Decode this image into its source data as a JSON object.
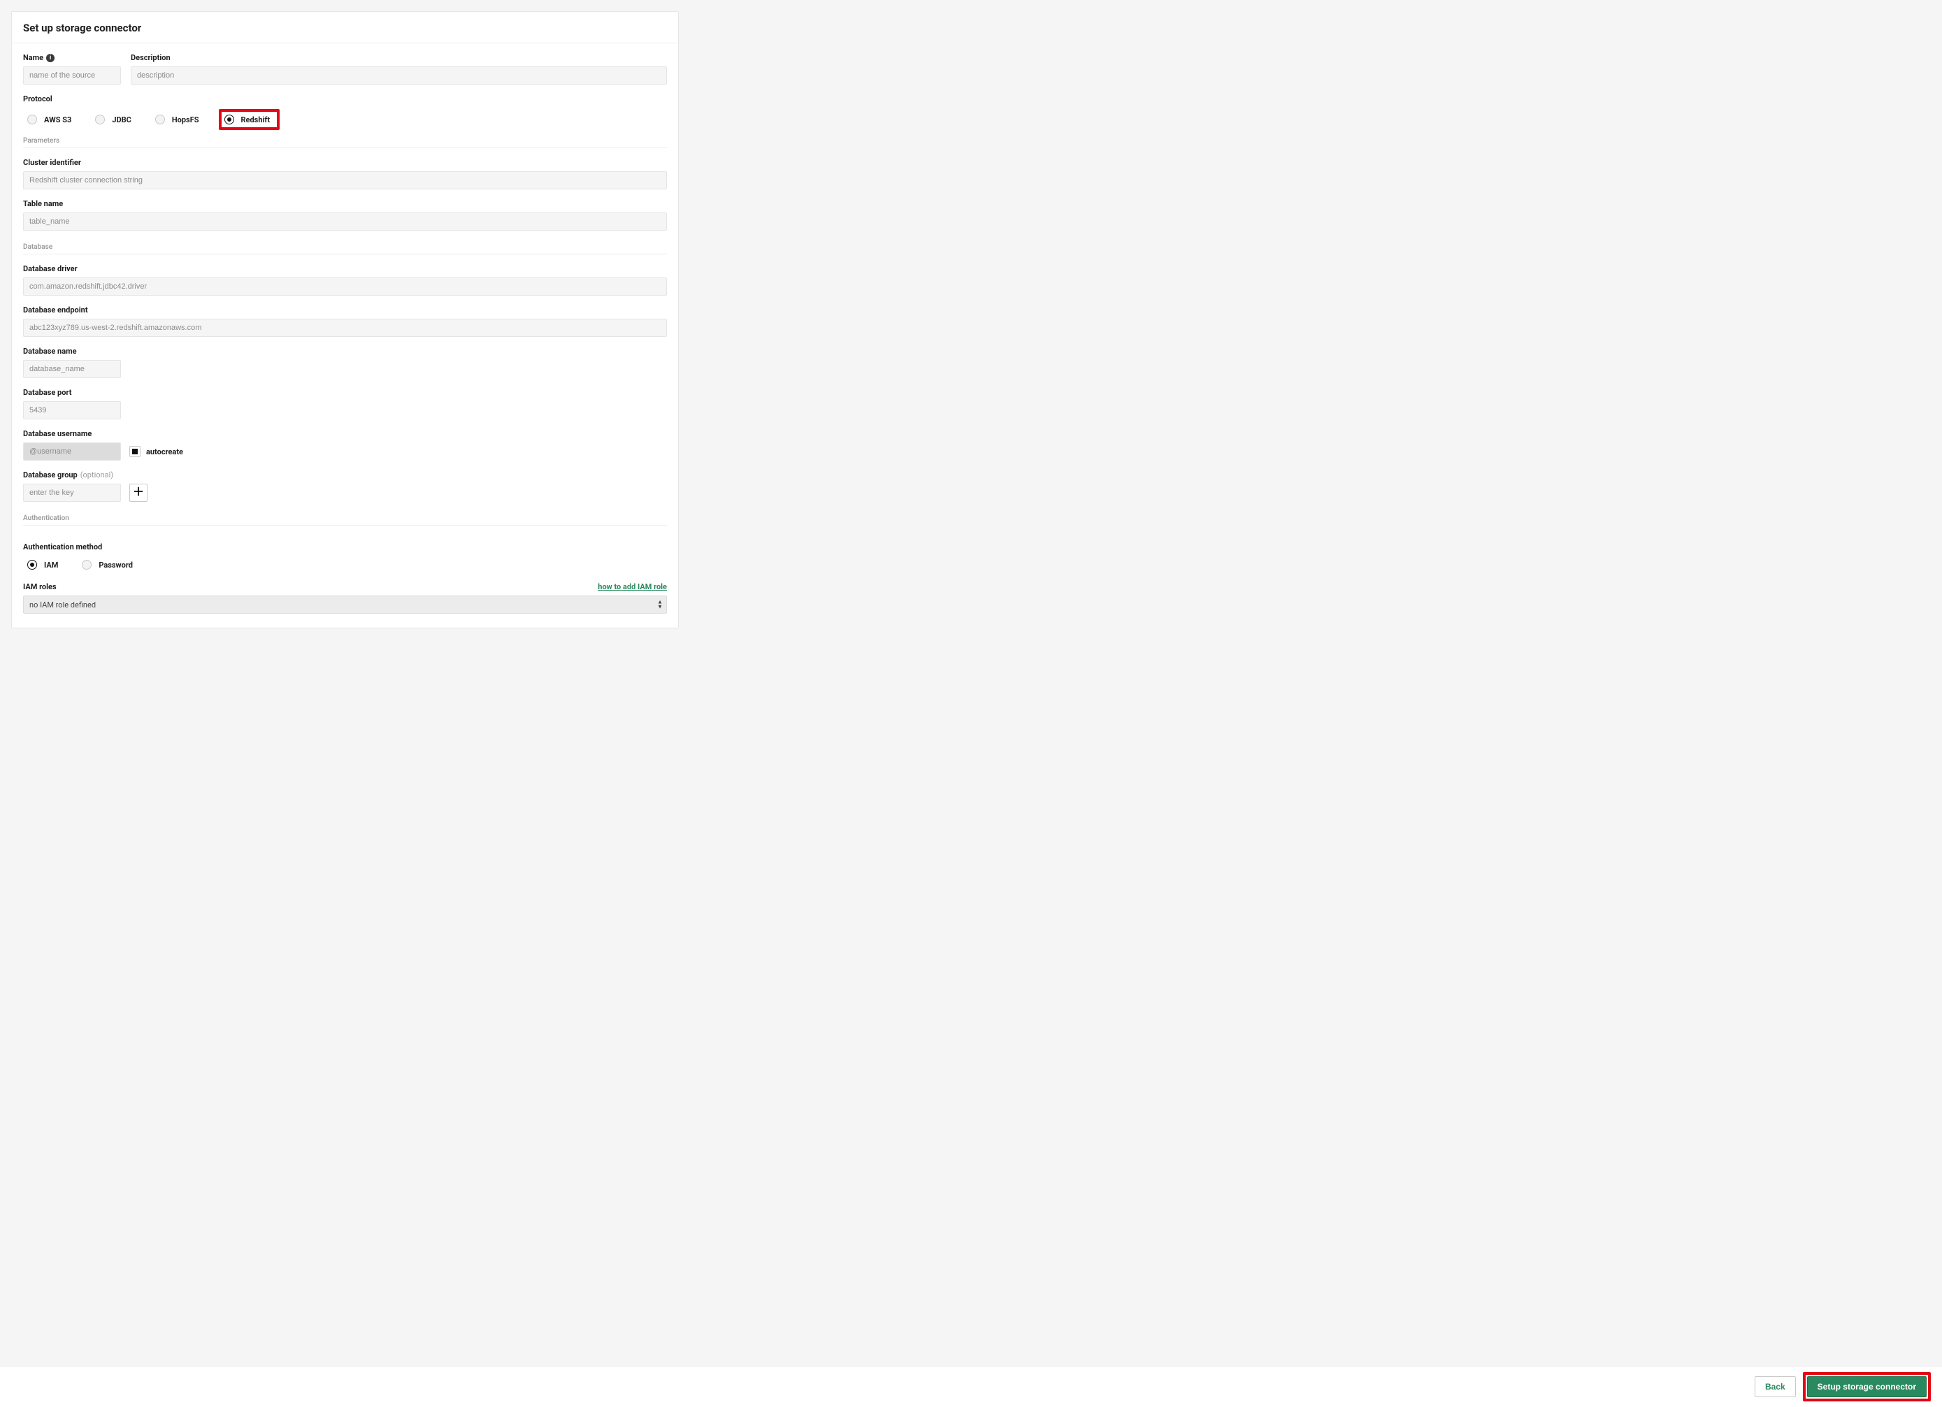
{
  "header": {
    "title": "Set up storage connector"
  },
  "form": {
    "name_label": "Name",
    "name_placeholder": "name of the source",
    "desc_label": "Description",
    "desc_placeholder": "description",
    "protocol_label": "Protocol",
    "protocols": [
      {
        "label": "AWS S3",
        "selected": false
      },
      {
        "label": "JDBC",
        "selected": false
      },
      {
        "label": "HopsFS",
        "selected": false
      },
      {
        "label": "Redshift",
        "selected": true
      }
    ],
    "section_parameters": "Parameters",
    "cluster_identifier": {
      "label": "Cluster identifier",
      "placeholder": "Redshift cluster connection string"
    },
    "table_name": {
      "label": "Table name",
      "placeholder": "table_name"
    },
    "section_database": "Database",
    "db_driver": {
      "label": "Database driver",
      "placeholder": "com.amazon.redshift.jdbc42.driver"
    },
    "db_endpoint": {
      "label": "Database endpoint",
      "placeholder": "abc123xyz789.us-west-2.redshift.amazonaws.com"
    },
    "db_name": {
      "label": "Database name",
      "placeholder": "database_name"
    },
    "db_port": {
      "label": "Database port",
      "placeholder": "5439"
    },
    "db_username": {
      "label": "Database username",
      "placeholder": "@username",
      "autocreate_label": "autocreate"
    },
    "db_group": {
      "label": "Database group",
      "optional": "(optional)",
      "placeholder": "enter the key"
    },
    "section_auth": "Authentication",
    "auth_method_label": "Authentication method",
    "auth_methods": [
      {
        "label": "IAM",
        "selected": true
      },
      {
        "label": "Password",
        "selected": false
      }
    ],
    "iam_roles": {
      "label": "IAM roles",
      "link": "how to add IAM role",
      "select_value": "no IAM role defined"
    }
  },
  "footer": {
    "back": "Back",
    "submit": "Setup storage connector"
  }
}
